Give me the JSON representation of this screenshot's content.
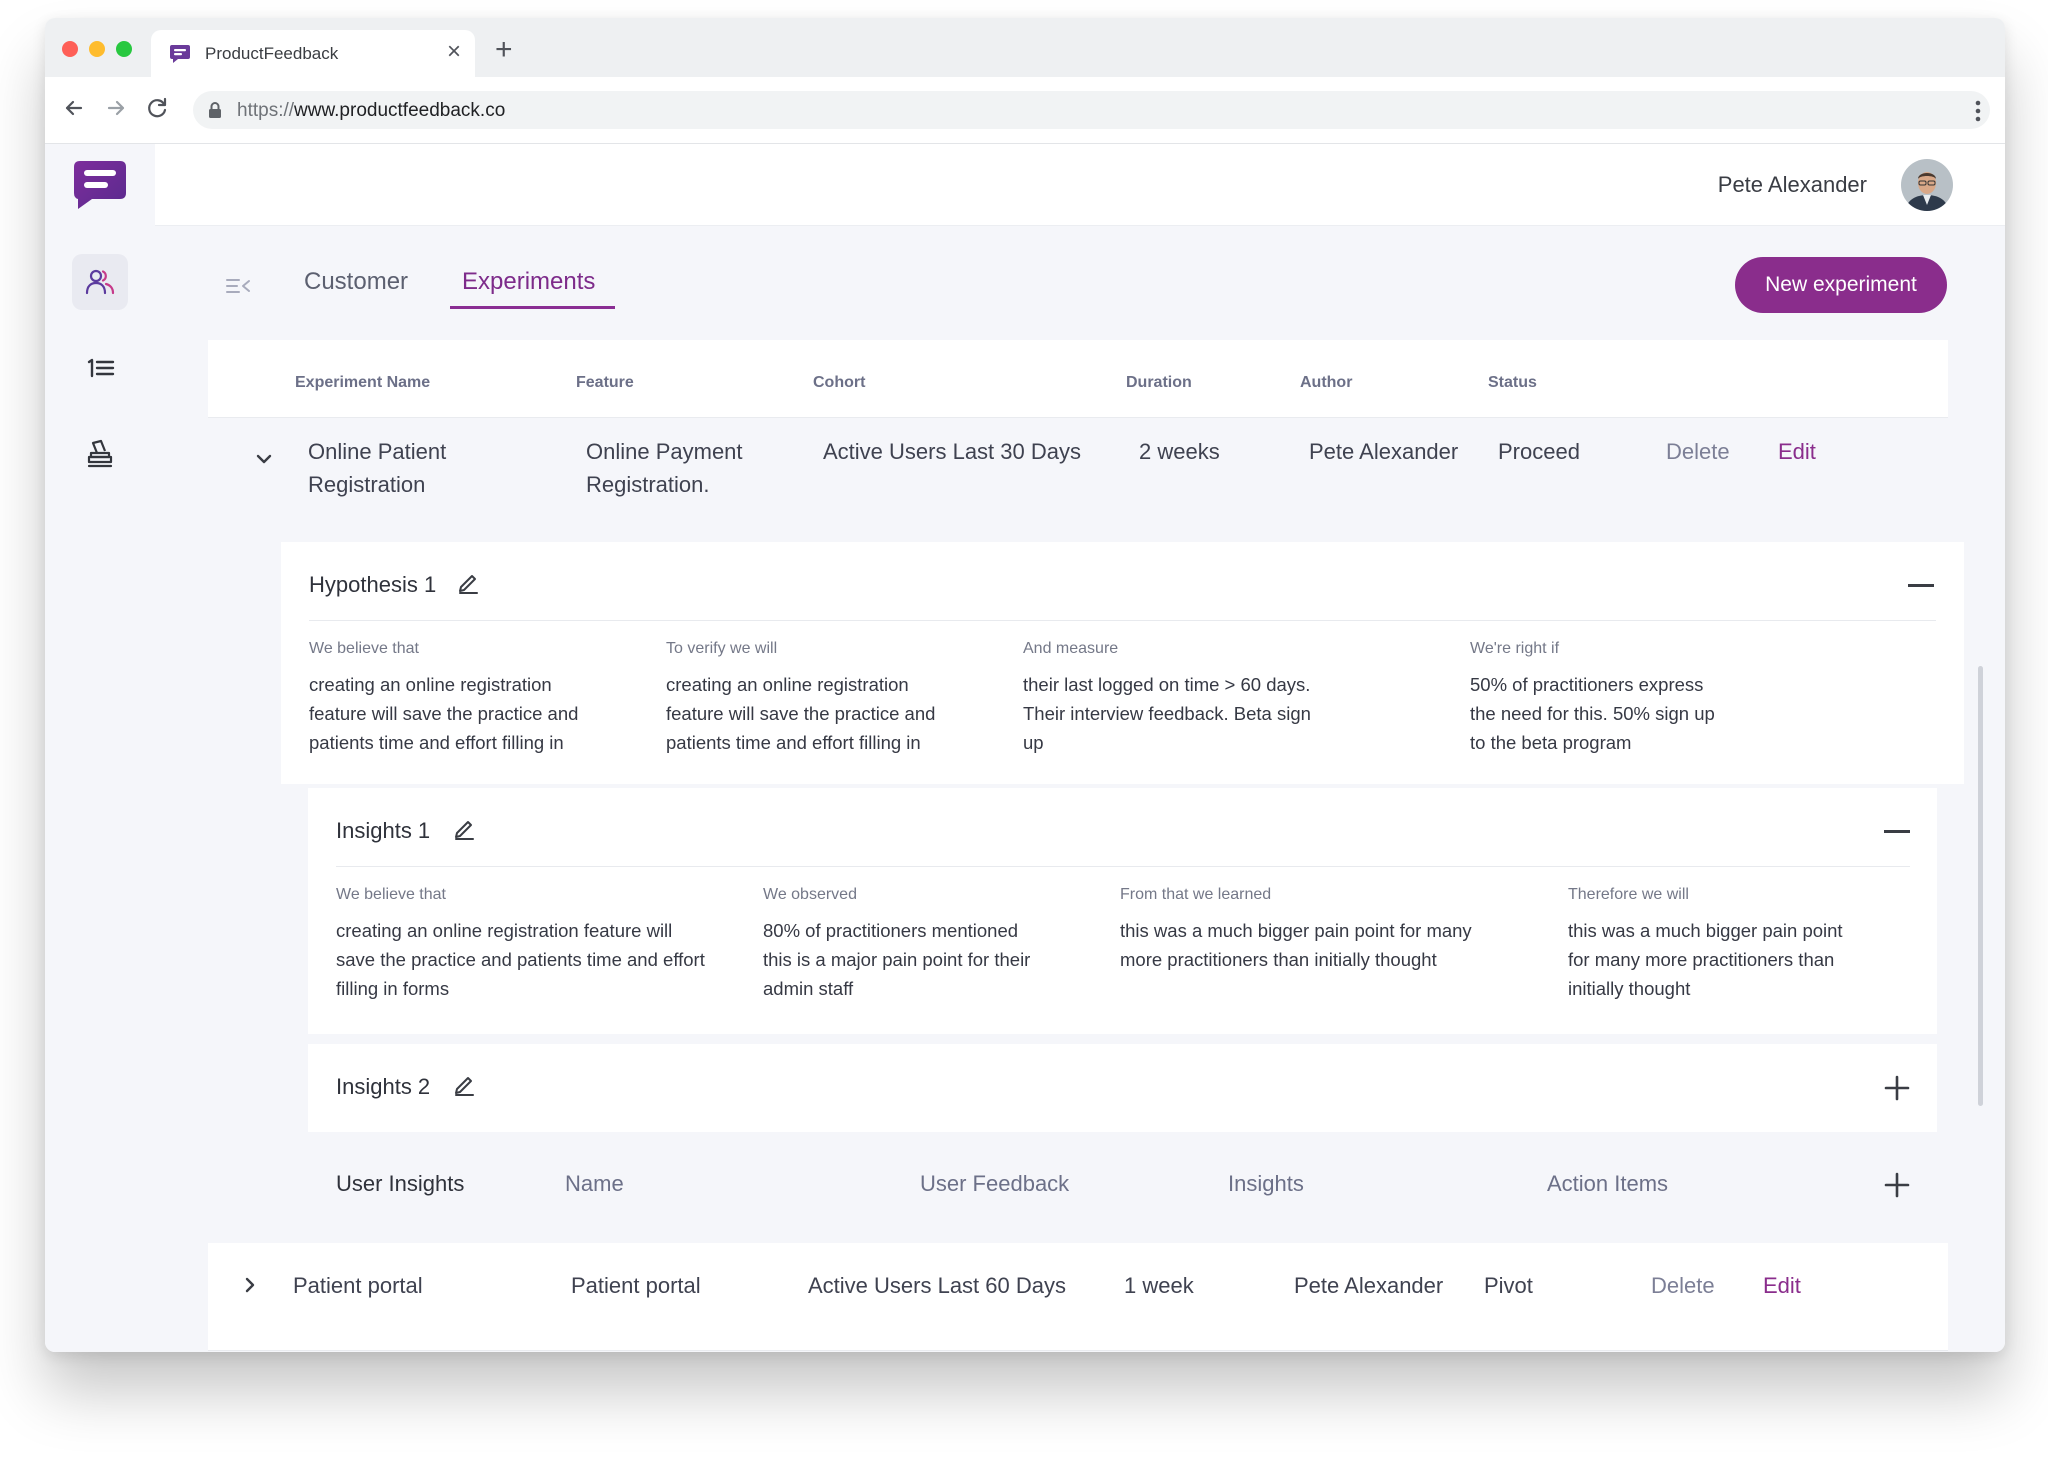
{
  "browser": {
    "tab_title": "ProductFeedback",
    "url_scheme": "https://",
    "url_host": "www.productfeedback.co"
  },
  "colors": {
    "accent": "#8a2d8c",
    "sidebar_bg": "#f5f6fa",
    "content_bg": "#f5f6fa"
  },
  "sidebar": {
    "items": [
      {
        "icon": "users-icon",
        "active": true
      },
      {
        "icon": "numbered-list-icon",
        "active": false
      },
      {
        "icon": "stamp-icon",
        "active": false
      }
    ]
  },
  "header": {
    "user_name": "Pete Alexander"
  },
  "tabs": [
    {
      "label": "Customer",
      "active": false
    },
    {
      "label": "Experiments",
      "active": true
    }
  ],
  "actions": {
    "new_experiment": "New experiment"
  },
  "table": {
    "columns": [
      "Experiment Name",
      "Feature",
      "Cohort",
      "Duration",
      "Author",
      "Status"
    ],
    "rows": [
      {
        "name_line1": "Online Patient",
        "name_line2": "Registration",
        "feature_line1": "Online Payment",
        "feature_line2": "Registration.",
        "cohort": "Active Users Last 30 Days",
        "duration": "2 weeks",
        "author": "Pete Alexander",
        "status": "Proceed",
        "delete": "Delete",
        "edit": "Edit",
        "expanded": true
      },
      {
        "name": "Patient portal",
        "feature": "Patient portal",
        "cohort": "Active Users Last 60 Days",
        "duration": "1 week",
        "author": "Pete Alexander",
        "status": "Pivot",
        "delete": "Delete",
        "edit": "Edit",
        "expanded": false
      }
    ]
  },
  "hypothesis": {
    "title": "Hypothesis 1",
    "columns": [
      {
        "label": "We believe that",
        "lines": [
          "creating an online registration",
          "feature will save the practice and",
          "patients time and effort filling in"
        ]
      },
      {
        "label": "To verify we will",
        "lines": [
          "creating an online registration",
          "feature will save the practice and",
          "patients time and effort filling in"
        ]
      },
      {
        "label": "And measure",
        "lines": [
          "their last logged on time > 60 days.",
          "Their interview feedback. Beta sign",
          "up"
        ]
      },
      {
        "label": "We're right if",
        "lines": [
          "50% of practitioners express",
          "the need for this. 50% sign up",
          "to the beta program"
        ]
      }
    ]
  },
  "insights1": {
    "title": "Insights 1",
    "columns": [
      {
        "label": "We believe that",
        "lines": [
          "creating an online registration feature will",
          "save the practice and patients time and effort",
          "filling in forms"
        ]
      },
      {
        "label": "We observed",
        "lines": [
          "80% of practitioners mentioned",
          "this is a major pain point for their",
          "admin staff"
        ]
      },
      {
        "label": "From that we learned",
        "lines": [
          "this was a much bigger pain point for many",
          "more practitioners than initially thought"
        ]
      },
      {
        "label": "Therefore we will",
        "lines": [
          "this was a much bigger pain point",
          "for many more practitioners than",
          "initially thought"
        ]
      }
    ]
  },
  "insights2": {
    "title": "Insights 2"
  },
  "user_insights": {
    "title": "User Insights",
    "columns": [
      "Name",
      "User Feedback",
      "Insights",
      "Action Items"
    ]
  }
}
